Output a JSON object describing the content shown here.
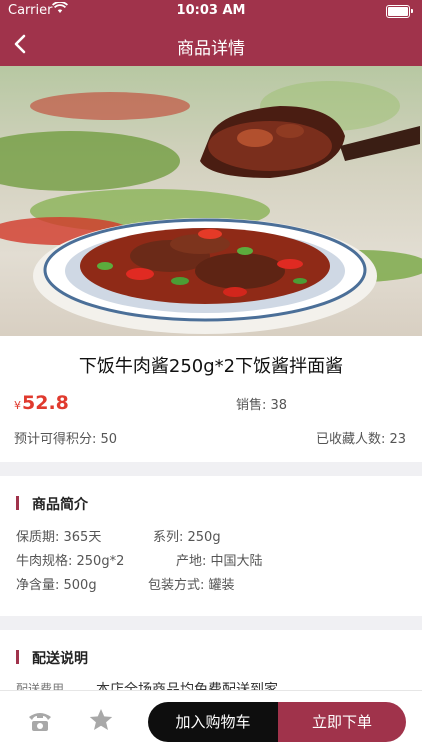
{
  "status_bar": {
    "carrier": "Carrier",
    "time": "10:03 AM"
  },
  "nav": {
    "title": "商品详情",
    "back_icon": "chevron-left-icon"
  },
  "hero": {
    "alt": "product-photo"
  },
  "product": {
    "title": "下饭牛肉酱250g*2下饭酱拌面酱",
    "price_symbol": "¥",
    "price": "52.8",
    "sales": "销售: 38",
    "points": "预计可得积分: 50",
    "favorites": "已收藏人数: 23"
  },
  "intro": {
    "heading": "商品简介",
    "shelf_life": "保质期: 365天",
    "series": "系列: 250g",
    "spec": "牛肉规格: 250g*2",
    "origin": "产地: 中国大陆",
    "net": "净含量: 500g",
    "packaging": "包装方式: 罐装"
  },
  "delivery": {
    "heading": "配送说明",
    "fee_label": "配送费用",
    "fee_value": "本店全场商品均免费配送到家"
  },
  "bottom": {
    "phone_icon": "phone-icon",
    "star_icon": "star-icon",
    "add_to_cart": "加入购物车",
    "buy_now": "立即下单"
  },
  "colors": {
    "brand": "#a0334b",
    "price": "#e03a2e",
    "cart_button": "#0e0e0e"
  }
}
